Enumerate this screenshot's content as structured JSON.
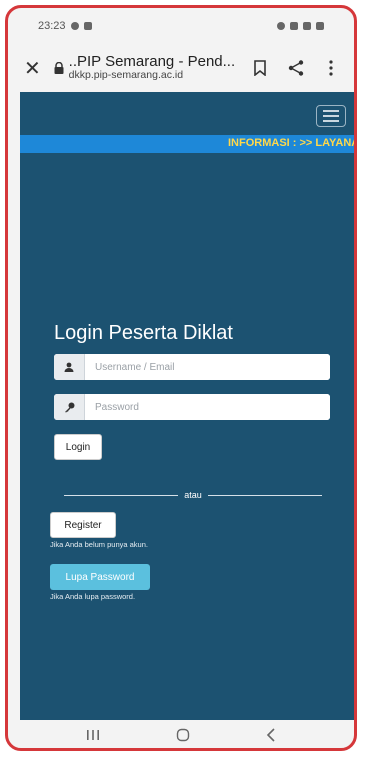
{
  "status_bar": {
    "time": "23:23"
  },
  "browser": {
    "close_glyph": "✕",
    "page_title": "..PIP Semarang - Pend...",
    "host": "dkkp.pip-semarang.ac.id"
  },
  "ticker": {
    "text": "INFORMASI : >> LAYANAN"
  },
  "login": {
    "title": "Login Peserta Diklat",
    "username_placeholder": "Username / Email",
    "password_placeholder": "Password",
    "login_button": "Login",
    "divider_text": "atau",
    "register_button": "Register",
    "register_hint": "Jika Anda belum punya akun.",
    "forgot_button": "Lupa Password",
    "forgot_hint": "Jika Anda lupa password."
  },
  "colors": {
    "page_background": "#1c5271",
    "ticker_background": "#1e88d8",
    "ticker_text": "#ffd84a",
    "forgot_button": "#5bc0de",
    "frame_border": "#d5373a"
  }
}
